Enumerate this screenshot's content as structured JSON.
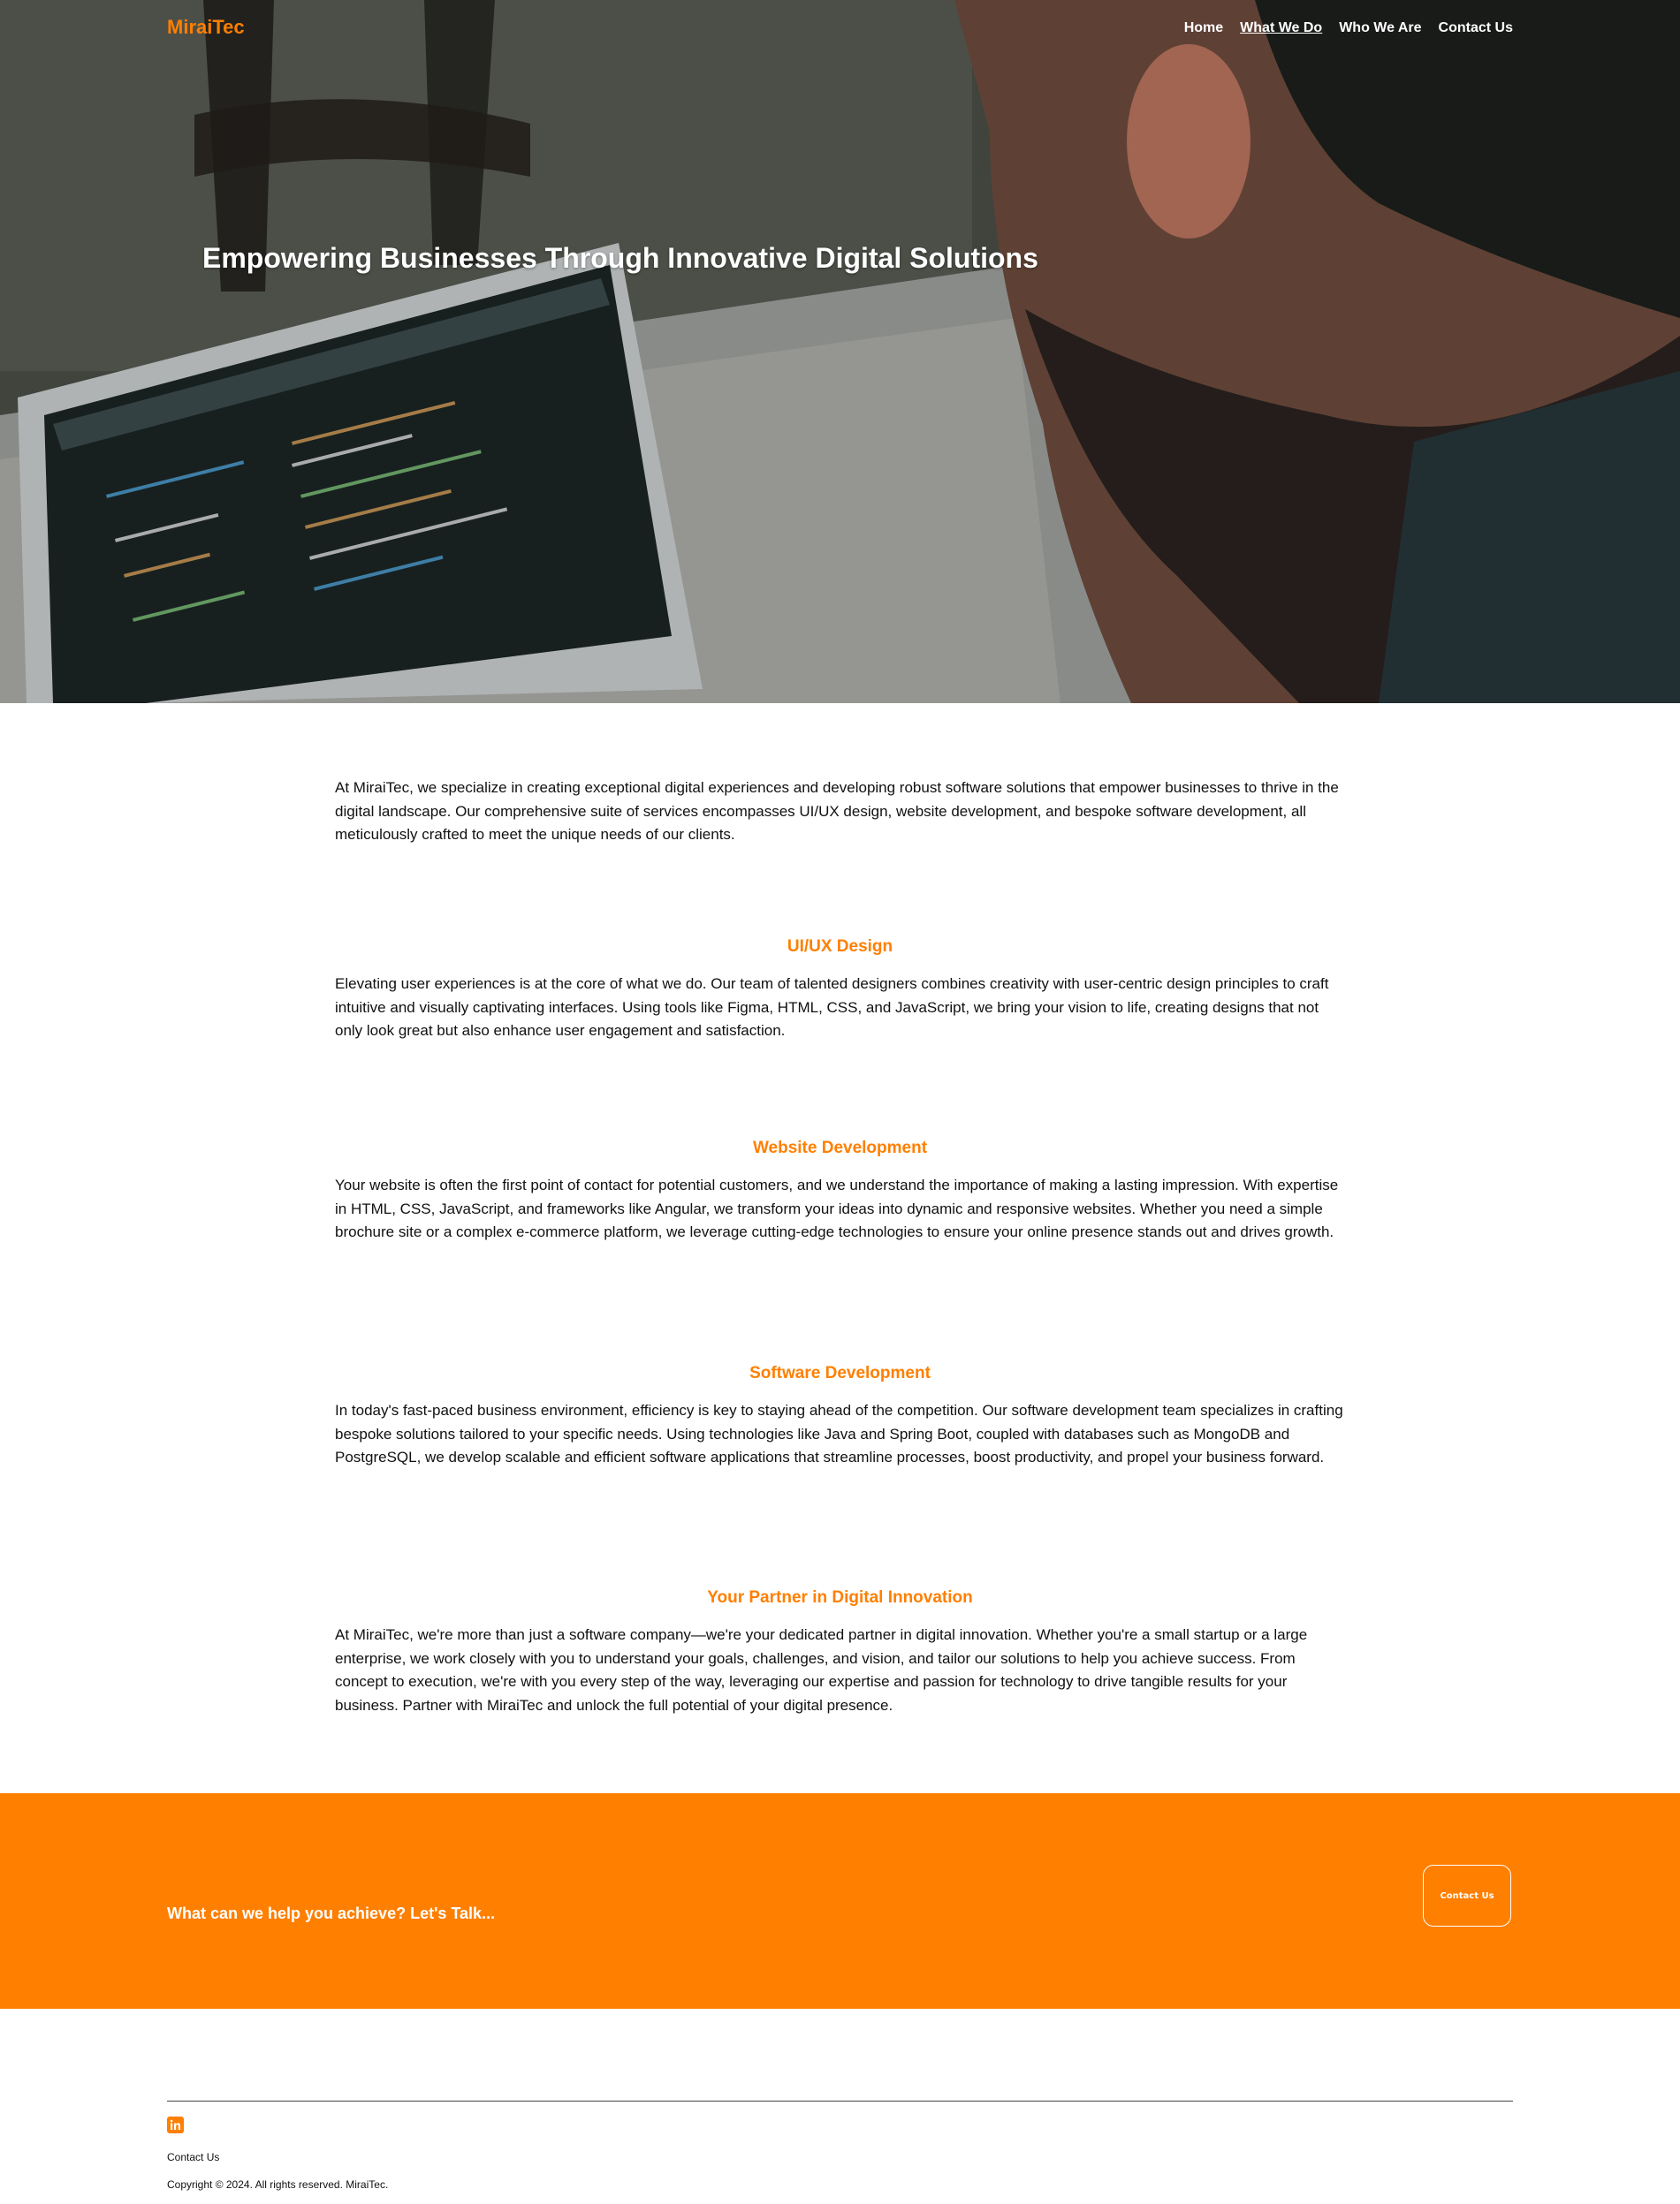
{
  "brand": {
    "name": "MiraiTec",
    "accent_color": "#ff7f00"
  },
  "nav": {
    "items": [
      {
        "label": "Home",
        "active": false
      },
      {
        "label": "What We Do",
        "active": true
      },
      {
        "label": "Who We Are",
        "active": false
      },
      {
        "label": "Contact Us",
        "active": false
      }
    ]
  },
  "hero": {
    "title": "Empowering Businesses Through Innovative Digital Solutions",
    "image": "developer-at-laptop-photo"
  },
  "intro": "At MiraiTec, we specialize in creating exceptional digital experiences and developing robust software solutions that empower businesses to thrive in the digital landscape. Our comprehensive suite of services encompasses UI/UX design, website development, and bespoke software development, all meticulously crafted to meet the unique needs of our clients.",
  "services": [
    {
      "title": "UI/UX Design",
      "text": "Elevating user experiences is at the core of what we do. Our team of talented designers combines creativity with user-centric design principles to craft intuitive and visually captivating interfaces. Using tools like Figma, HTML, CSS, and JavaScript, we bring your vision to life, creating designs that not only look great but also enhance user engagement and satisfaction."
    },
    {
      "title": "Website Development",
      "text": "Your website is often the first point of contact for potential customers, and we understand the importance of making a lasting impression. With expertise in HTML, CSS, JavaScript, and frameworks like Angular, we transform your ideas into dynamic and responsive websites. Whether you need a simple brochure site or a complex e-commerce platform, we leverage cutting-edge technologies to ensure your online presence stands out and drives growth."
    },
    {
      "title": "Software Development",
      "text": "In today's fast-paced business environment, efficiency is key to staying ahead of the competition. Our software development team specializes in crafting bespoke solutions tailored to your specific needs. Using technologies like Java and Spring Boot, coupled with databases such as MongoDB and PostgreSQL, we develop scalable and efficient software applications that streamline processes, boost productivity, and propel your business forward."
    },
    {
      "title": "Your Partner in Digital Innovation",
      "text": "At MiraiTec, we're more than just a software company—we're your dedicated partner in digital innovation. Whether you're a small startup or a large enterprise, we work closely with you to understand your goals, challenges, and vision, and tailor our solutions to help you achieve success. From concept to execution, we're with you every step of the way, leveraging our expertise and passion for technology to drive tangible results for your business. Partner with MiraiTec and unlock the full potential of your digital presence."
    }
  ],
  "cta": {
    "text": "What can we help you achieve? Let's Talk...",
    "button_label": "Contact Us"
  },
  "footer": {
    "social_icon": "linkedin-icon",
    "contact_label": "Contact Us",
    "copyright": "Copyright © 2024. All rights reserved. MiraiTec."
  }
}
